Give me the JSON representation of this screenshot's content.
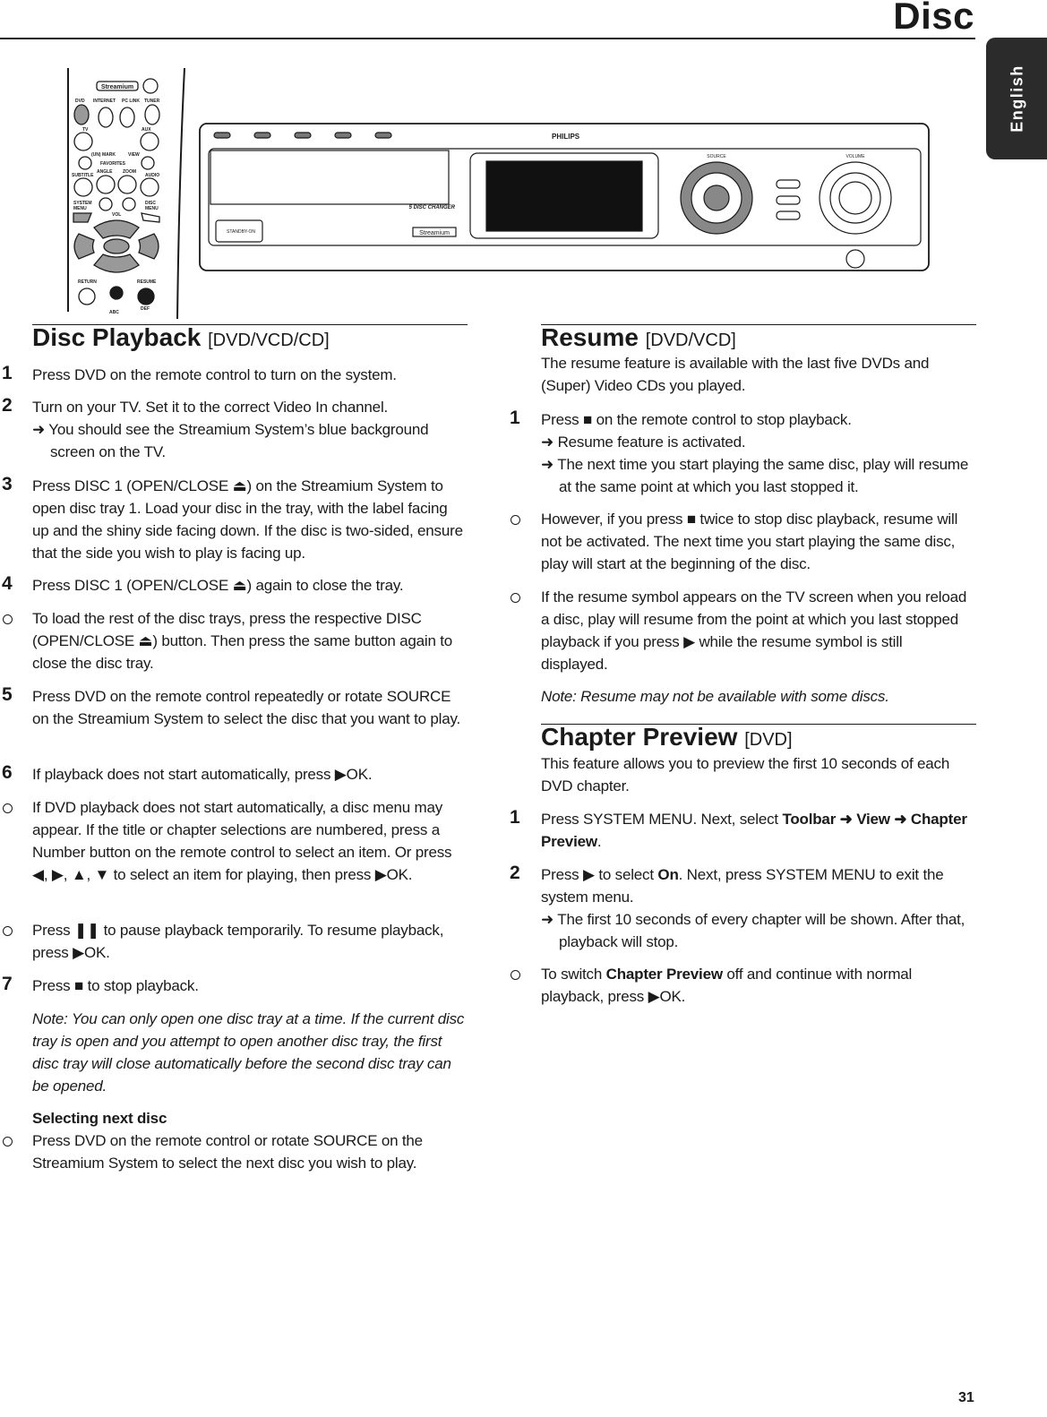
{
  "header": {
    "title": "Disc",
    "language_tab": "English",
    "page_number": "31"
  },
  "illustration": {
    "remote_brand": "Streamium",
    "remote_buttons": [
      "DVD",
      "INTERNET",
      "PC LINK",
      "TUNER",
      "TV",
      "AUX",
      "(UN) MARK",
      "VIEW",
      "FAVORITES",
      "SUBTITLE",
      "ANGLE",
      "ZOOM",
      "AUDIO",
      "SYSTEM MENU",
      "VOL",
      "DISC MENU",
      "OK",
      "RETURN",
      "RESUME",
      "ABC",
      "DEF"
    ],
    "device_brand": "PHILIPS",
    "device_labels": [
      "5 DISC CHANGER",
      "Streamium",
      "SOURCE",
      "VOLUME",
      "STANDBY-ON"
    ]
  },
  "left": {
    "heading": "Disc Playback",
    "heading_tag": "[DVD/VCD/CD]",
    "s1": {
      "n": "1",
      "t": "Press DVD on the remote control to turn on the system."
    },
    "s2": {
      "n": "2",
      "t": "Turn on your TV. Set it to the correct Video In channel.",
      "r": "➜ You should see the Streamium System’s blue background screen on the TV."
    },
    "s3": {
      "n": "3",
      "t": "Press DISC 1 (OPEN/CLOSE ⏏) on the Streamium System to open disc tray 1. Load your disc in the tray, with the label facing up and the shiny side facing down. If the disc is two-sided, ensure that the side you wish to play is facing up."
    },
    "s4": {
      "n": "4",
      "t": "Press DISC 1 (OPEN/CLOSE ⏏) again to close the tray."
    },
    "b1": "To load the rest of the disc trays, press the respective DISC (OPEN/CLOSE ⏏) button. Then press the same button again to close the disc tray.",
    "s5": {
      "n": "5",
      "t": "Press DVD on the remote control repeatedly or rotate SOURCE on the Streamium System to select the disc that you want to play."
    },
    "s6": {
      "n": "6",
      "t": "If playback does not start automatically, press ▶OK."
    },
    "b2": "If DVD playback does not start automatically, a disc menu may appear. If the title or chapter selections are numbered, press a Number button on the remote control to select an item. Or press ◀, ▶, ▲, ▼ to select an item for playing, then press ▶OK.",
    "b3": "Press ❚❚ to pause playback temporarily. To resume playback, press ▶OK.",
    "s7": {
      "n": "7",
      "t": "Press ■ to stop playback."
    },
    "note": "Note: You can only open one disc tray at a time. If the current disc tray is open and you attempt to open another disc tray, the first disc tray will close automatically before the second disc tray can be opened.",
    "sub": "Selecting next disc",
    "b4": "Press DVD on the remote control or rotate SOURCE on the Streamium System to select the next disc you wish to play."
  },
  "right": {
    "heading": "Resume",
    "heading_tag": "[DVD/VCD]",
    "intro": "The resume feature is available with the last five DVDs and (Super) Video CDs you played.",
    "s1": {
      "n": "1",
      "t": "Press ■ on the remote control to stop playback.",
      "r1": "➜ Resume feature is activated.",
      "r2": "➜ The next time you start playing the same disc, play will resume at the same point at which you last stopped it."
    },
    "b1": "However, if you press ■ twice to stop disc playback, resume will not be activated. The next time you start playing the same disc, play will start at the beginning of the disc.",
    "b2": "If the resume symbol appears on the TV screen when you reload a disc, play will resume from the point at which you last stopped playback if you press ▶ while the resume symbol is still displayed.",
    "note": "Note: Resume may not be available with some discs.",
    "heading2": "Chapter Preview",
    "heading2_tag": "[DVD]",
    "intro2": "This feature allows you to preview the first 10 seconds of each DVD chapter.",
    "c1": {
      "n": "1",
      "a": "Press SYSTEM MENU. Next, select ",
      "b": "Toolbar ➜ View ➜ Chapter Preview",
      "c": "."
    },
    "c2": {
      "n": "2",
      "a": "Press ▶ to select ",
      "b": "On",
      "c": ". Next, press SYSTEM MENU to exit the system menu.",
      "r": "➜ The first 10 seconds of every chapter will be shown. After that, playback will stop."
    },
    "b3": {
      "a": "To switch ",
      "b": "Chapter Preview",
      "c": " off and continue with normal playback, press ▶OK."
    }
  }
}
